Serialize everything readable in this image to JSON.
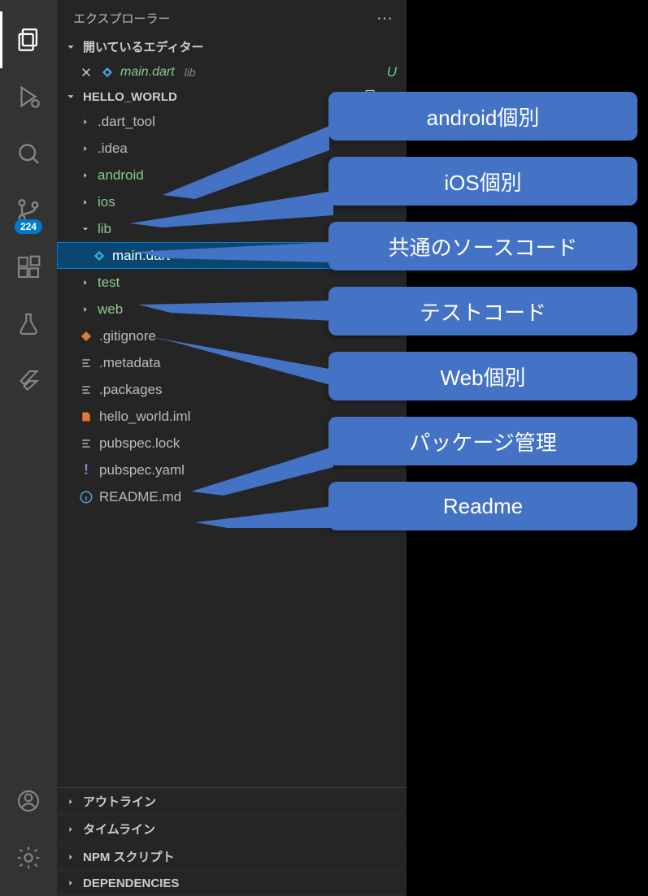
{
  "sidebar": {
    "title": "エクスプローラー",
    "open_editors_label": "開いているエディター",
    "project_name": "HELLO_WORLD",
    "badge_count": "224"
  },
  "open_editor": {
    "file": "main.dart",
    "dir": "lib",
    "status": "U"
  },
  "tree": {
    "dart_tool": ".dart_tool",
    "idea": ".idea",
    "android": "android",
    "ios": "ios",
    "lib": "lib",
    "main_dart": "main.dart",
    "test": "test",
    "web": "web",
    "gitignore": ".gitignore",
    "metadata": ".metadata",
    "packages": ".packages",
    "iml": "hello_world.iml",
    "pubspec_lock": "pubspec.lock",
    "pubspec_yaml": "pubspec.yaml",
    "readme": "README.md"
  },
  "bottom_panels": {
    "outline": "アウトライン",
    "timeline": "タイムライン",
    "npm": "NPM スクリプト",
    "deps": "DEPENDENCIES"
  },
  "callouts": {
    "android": "android個別",
    "ios": "iOS個別",
    "lib": "共通のソースコード",
    "test": "テストコード",
    "web": "Web個別",
    "pubspec": "パッケージ管理",
    "readme": "Readme"
  },
  "colors": {
    "folder_green": "#8dc891",
    "dart_blue": "#45b0e6",
    "orange": "#e37933",
    "purple": "#a074c4"
  }
}
